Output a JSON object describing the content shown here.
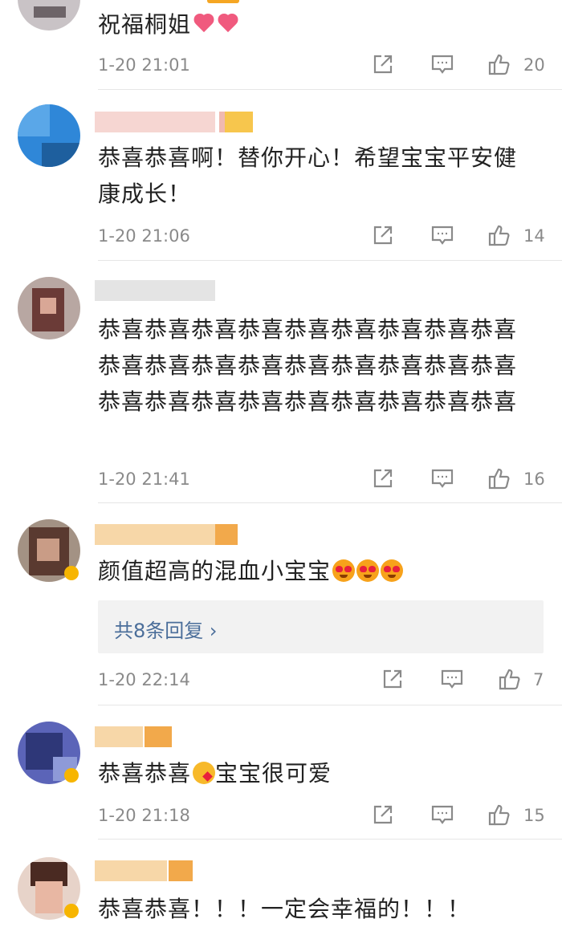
{
  "comments": [
    {
      "text": "祝福桐姐",
      "time": "1-20 21:01",
      "likes": "20"
    },
    {
      "text": "恭喜恭喜啊！替你开心！希望宝宝平安健康成长！",
      "time": "1-20 21:06",
      "likes": "14"
    },
    {
      "text": "恭喜恭喜恭喜恭喜恭喜恭喜恭喜恭喜恭喜恭喜恭喜恭喜恭喜恭喜恭喜恭喜恭喜恭喜恭喜恭喜恭喜恭喜恭喜恭喜恭喜恭喜恭喜",
      "time": "1-20 21:41",
      "likes": "16"
    },
    {
      "text": "颜值超高的混血小宝宝",
      "time": "1-20 22:14",
      "likes": "7",
      "replies": "共8条回复 ›"
    },
    {
      "text_a": "恭喜恭喜",
      "text_b": "宝宝很可爱",
      "time": "1-20 21:18",
      "likes": "15"
    },
    {
      "text": "恭喜恭喜！！！一定会幸福的！！！"
    }
  ],
  "icons": {
    "share": "share-icon",
    "comment": "comment-icon",
    "like": "thumbs-up-icon"
  },
  "colors": {
    "reply_link": "#4b6e9a",
    "meta_text": "#8a8a8a",
    "badge": "#f7b500"
  }
}
